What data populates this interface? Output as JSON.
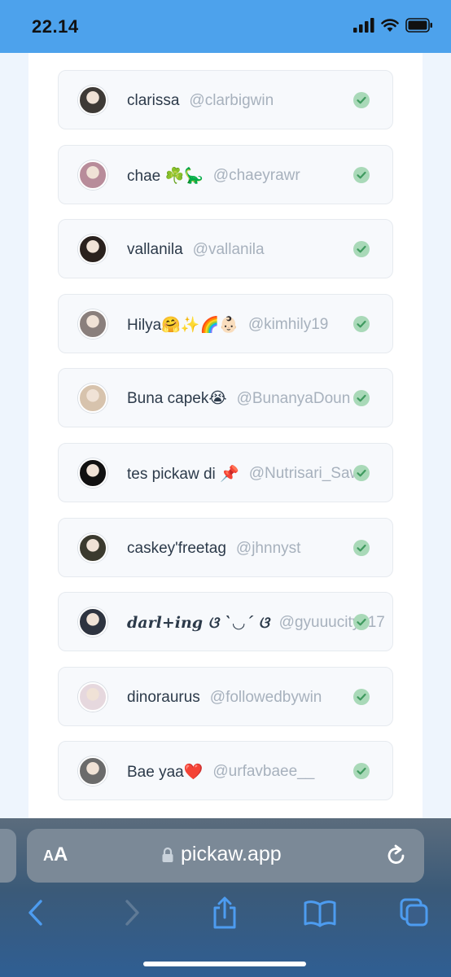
{
  "status_bar": {
    "time": "22.14"
  },
  "users": [
    {
      "name": "clarissa",
      "handle": "@clarbigwin",
      "avatar_color": "#3e3a36"
    },
    {
      "name": "chae ☘️🦕",
      "handle": "@chaeyrawr",
      "avatar_color": "#b88c9a"
    },
    {
      "name": "vallanila",
      "handle": "@vallanila",
      "avatar_color": "#2a211d"
    },
    {
      "name": "Hilya🤗✨🌈👶🏻",
      "handle": "@kimhily19",
      "avatar_color": "#8a7f7c"
    },
    {
      "name": "Buna capek😭",
      "handle": "@BunanyaDoun",
      "avatar_color": "#d7c3ad"
    },
    {
      "name": "tes pickaw di 📌",
      "handle": "@Nutrisari_Sawo",
      "avatar_color": "#111111"
    },
    {
      "name": "caskey'freetag",
      "handle": "@jhnnyst",
      "avatar_color": "#3b3a2e"
    },
    {
      "name": "darl+ing ଓ ˋ◡ˊ ଓ",
      "handle": "@gyuuucityx17",
      "avatar_color": "#2e3440"
    },
    {
      "name": "dinoraurus",
      "handle": "@followedbywin",
      "avatar_color": "#e6d8de"
    },
    {
      "name": "Bae yaa❤️",
      "handle": "@urfavbaee__",
      "avatar_color": "#6b6b6b"
    }
  ],
  "browser": {
    "aa_label_small": "A",
    "aa_label_big": "A",
    "url": "pickaw.app"
  },
  "colors": {
    "status_bar": "#4da2ec",
    "check_fill": "#a9d9b8",
    "check_mark": "#3f9a5f",
    "toolbar_icon": "#4d9cf0"
  }
}
